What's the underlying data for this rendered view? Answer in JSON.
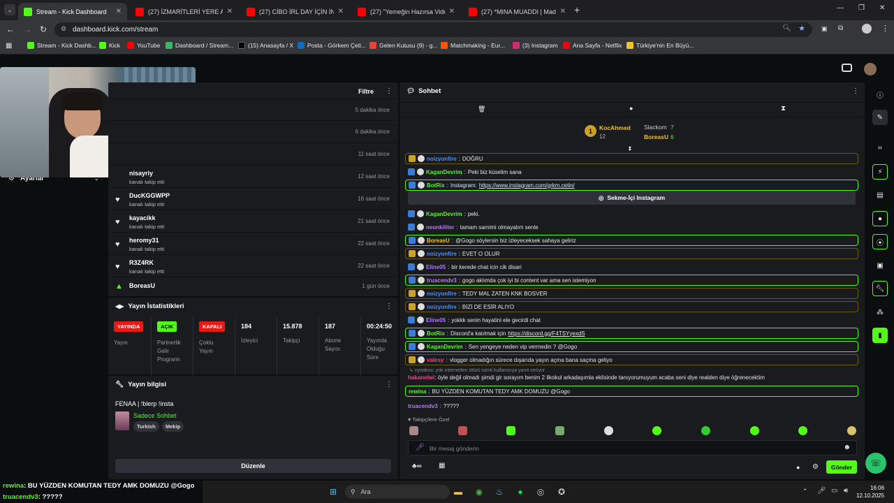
{
  "browser": {
    "tabs": [
      {
        "title": "Stream - Kick Dashboard",
        "active": true
      },
      {
        "title": "(27) İZMARİTLERİ YERE ATMIYA"
      },
      {
        "title": "(27) CİBO İRL DAY İÇİN İNSTA'D"
      },
      {
        "title": "(27) \"Yemeğin Hazırsa Video Ha"
      },
      {
        "title": "(27) *MINA MUADDI | Madara (..."
      }
    ],
    "url": "dashboard.kick.com/stream",
    "bookmarks": [
      "Stream - Kick Dashb...",
      "Kick",
      "YouTube",
      "Dashboard / Stream...",
      "(15) Anasayfa / X",
      "Posta - Görkem Çeti...",
      "Gelen Kutusu (9) - g...",
      "Matchmaking - Eur...",
      "(3) Instagram",
      "Ana Sayfa - Netflix",
      "Türkiye'nin En Büyü..."
    ]
  },
  "nav": {
    "settings_label": "Ayarlar"
  },
  "activity": {
    "filter_label": "Filtre",
    "items": [
      {
        "name": "",
        "sub": "",
        "time": "5 dakika önce"
      },
      {
        "name": "",
        "sub": "",
        "time": "6 dakika önce"
      },
      {
        "name": "",
        "sub": "",
        "time": "11 saat önce"
      },
      {
        "name": "nisayriy",
        "sub": "kanalı takip etti",
        "time": "12 saat önce"
      },
      {
        "name": "DucKGGWPP",
        "sub": "kanalı takip etti",
        "time": "16 saat önce"
      },
      {
        "name": "kayacikk",
        "sub": "kanalı takip etti",
        "time": "21 saat önce"
      },
      {
        "name": "heromy31",
        "sub": "kanalı takip etti",
        "time": "22 saat önce"
      },
      {
        "name": "R3Z4RK",
        "sub": "kanalı takip etti",
        "time": "22 saat önce"
      },
      {
        "name": "BoreasU",
        "sub": "",
        "time": "1 gün önce"
      }
    ]
  },
  "stats": {
    "title": "Yayın İstatistikleri",
    "cols": [
      {
        "badge": "YAYINDA",
        "label": "Yayın",
        "color": "#e91916"
      },
      {
        "badge": "AÇIK",
        "label": "Partnerlik Gelir Programı",
        "color": "#53fc18"
      },
      {
        "badge": "KAPALI",
        "label": "Çoklu Yayın",
        "color": "#e91916"
      },
      {
        "value": "184",
        "label": "İzleyici"
      },
      {
        "value": "15.878",
        "label": "Takipçi"
      },
      {
        "value": "187",
        "label": "Abone Sayısı"
      },
      {
        "value": "00:24:50",
        "label": "Yayında Olduğu Süre"
      }
    ]
  },
  "streaminfo": {
    "title": "Yayın bilgisi",
    "stream_title": "FENAA | !blerp !insta",
    "category": "Sadece Sohbet",
    "tags": [
      "Turkish",
      "Mekip"
    ],
    "edit_label": "Düzenle"
  },
  "chat": {
    "title": "Sohbet",
    "leaderboard": {
      "first": {
        "name": "KocAhmed",
        "count": "12"
      },
      "second": {
        "name": "Slackom",
        "count": "7"
      },
      "third": {
        "name": "BoreasU",
        "count": "6"
      }
    },
    "messages": [
      {
        "user": "noizyonfire",
        "text": "DOĞRU",
        "color": "#4d8ef7",
        "style": "hly"
      },
      {
        "user": "KaganDevrim",
        "text": "Peki biz küselim sana",
        "color": "#53fc18",
        "style": ""
      },
      {
        "user": "BotRix",
        "text": "Instagram: ",
        "link": "https://www.instagram.com/grkm.cetin/",
        "color": "#53fc18",
        "style": "hl"
      },
      {
        "user": "KaganDevrim",
        "text": "peki.",
        "color": "#53fc18",
        "style": ""
      },
      {
        "user": "neonkiliter",
        "text": "tamam samimi olmayalım senle",
        "color": "#b07cf5",
        "style": ""
      },
      {
        "user": "BoreasU",
        "text": "@Gogo söylersin biz izleyeceksek sahaya geliriz",
        "color": "#f2c12e",
        "style": "hl"
      },
      {
        "user": "noizyonfire",
        "text": "EVET O OLUR",
        "color": "#4d8ef7",
        "style": "hly"
      },
      {
        "user": "Eline05",
        "text": "bir kerede chat icin cik disari",
        "color": "#b07cf5",
        "style": ""
      },
      {
        "user": "truacendv3",
        "text": "gogo aklımda çok iyi bi content var ama sen istemiyon",
        "color": "#b07cf5",
        "style": "hl"
      },
      {
        "user": "noizyonfire",
        "text": "TEDY MAL ZATEN KNK BOSVER",
        "color": "#4d8ef7",
        "style": "hly"
      },
      {
        "user": "noizyonfire",
        "text": "BİZİ DE ESİR ALIYO",
        "color": "#4d8ef7",
        "style": "hly"
      },
      {
        "user": "Eline05",
        "text": "yokkk senin hayatini ele gecirdi chat",
        "color": "#b07cf5",
        "style": ""
      },
      {
        "user": "BotRix",
        "text": "Discord'a katılmak için ",
        "link": "https://discord.gg/F4TSYyexdS",
        "color": "#53fc18",
        "style": "hl"
      },
      {
        "user": "KaganDevrim",
        "text": "Sen yengeye neden vip vermedin ? @Gogo",
        "color": "#53fc18",
        "style": "hl"
      },
      {
        "user": "valesy",
        "text": "vlogger olmadığın sürece dışarıda yayın açma bana saçma geliyo",
        "color": "#e84a8a",
        "style": "hly"
      }
    ],
    "reply_context": "nyndexx: yok internetten ötürü isimli kullanıcıya yanıt veriyor",
    "long_message": {
      "user": "hakanelwi",
      "text": "öyle değil olmadı şimdi gir sorayım benim 2 ilkokul arkadaşımla eklisinde tanıyorumuyum acaba seni diye realden diye öğrenecektim",
      "color": "#e84a8a"
    },
    "bottom_messages": [
      {
        "user": "rewina",
        "text": "BU YÜZDEN KOMUTAN TEDY AMK DOMUZU @Gogo",
        "color": "#53fc18",
        "style": "hl"
      },
      {
        "user": "truacendv3",
        "text": "?????",
        "color": "#b07cf5",
        "style": ""
      }
    ],
    "followers_only": "Takipçilere Özel",
    "instagram_button": "Sekme-İçi Instagram",
    "input_placeholder": "Bir mesaj gönderin",
    "send_label": "Gönder"
  },
  "overlay": {
    "line1_user": "rewina",
    "line1_text": ": BU YÜZDEN KOMUTAN TEDY AMK DOMUZU @Gogo",
    "line2_user": "truacendv3",
    "line2_text": ": ?????"
  },
  "taskbar": {
    "search_label": "Ara",
    "time": "16:06",
    "date": "12.10.2025"
  },
  "colors": {
    "accent": "#53fc18",
    "panel": "#191b1f",
    "bg": "#0b0e0f"
  }
}
